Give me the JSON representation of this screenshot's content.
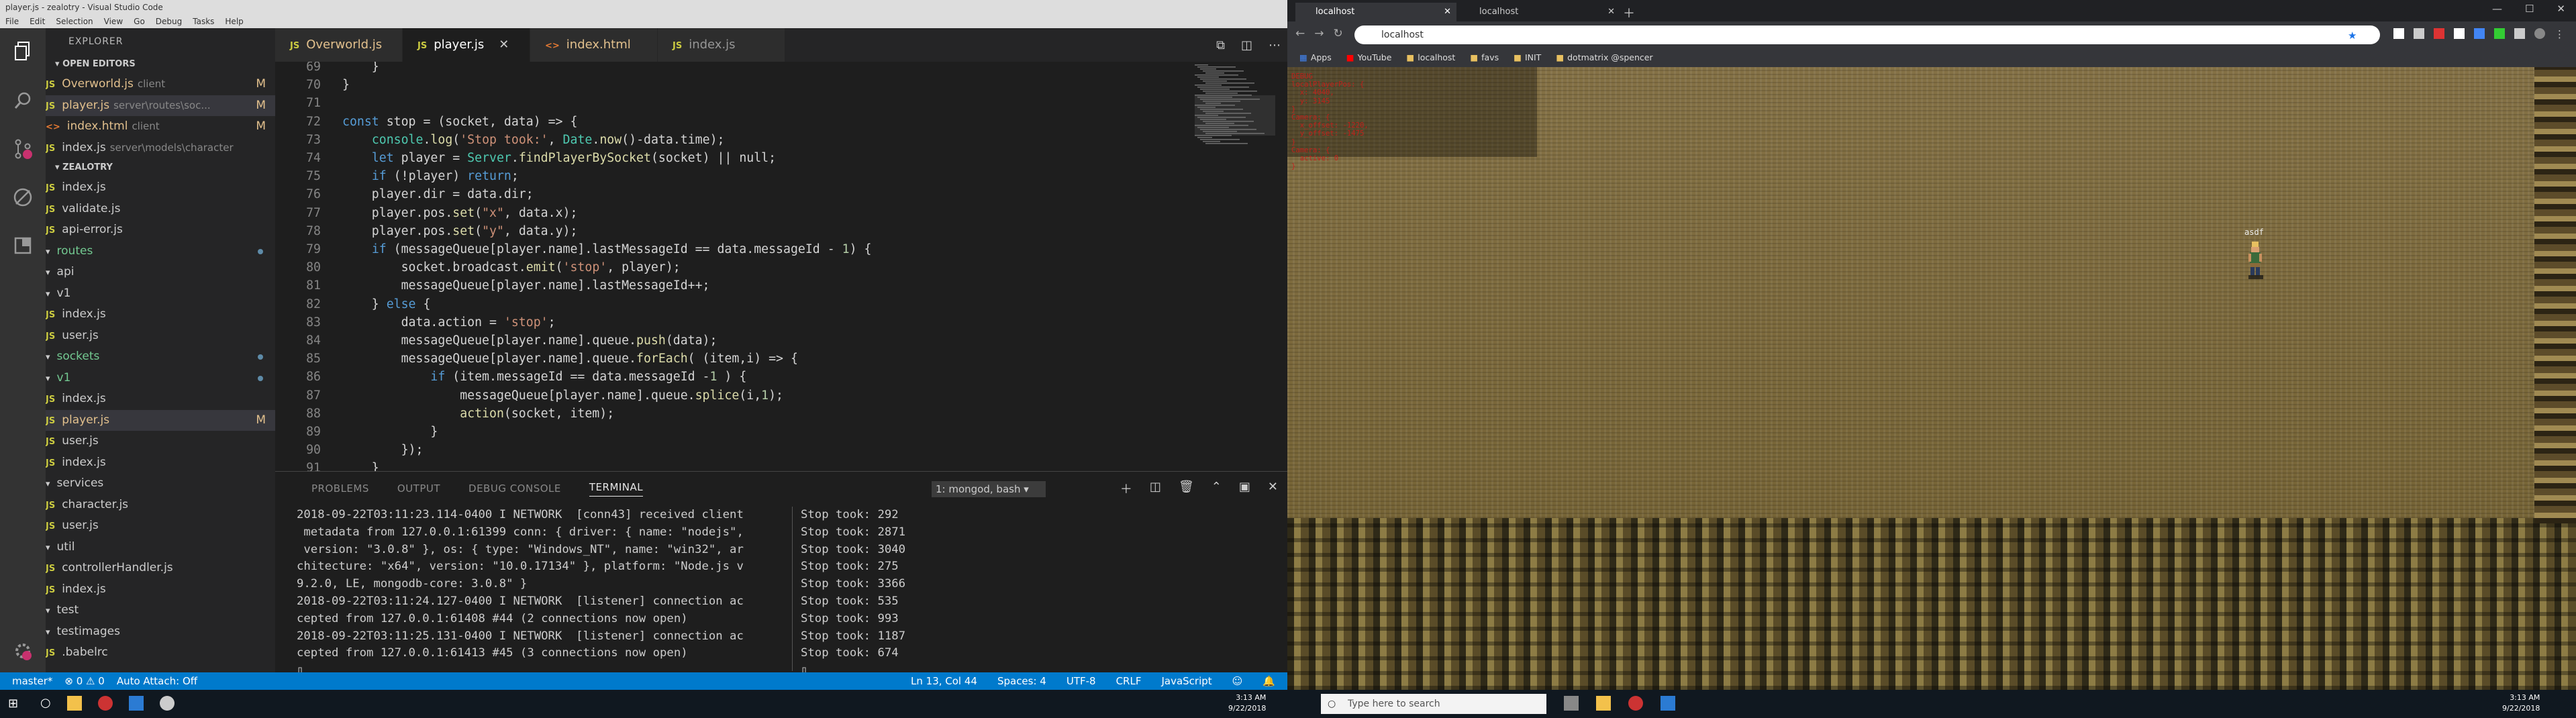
{
  "vs": {
    "title": "player.js - zealotry - Visual Studio Code",
    "menu": [
      "File",
      "Edit",
      "Selection",
      "View",
      "Go",
      "Debug",
      "Tasks",
      "Help"
    ],
    "explorer_title": "EXPLORER",
    "open_editors_label": "OPEN EDITORS",
    "open_editors": [
      {
        "name": "Overworld.js",
        "dir": "client",
        "badge": "M"
      },
      {
        "name": "player.js",
        "dir": "server\\routes\\soc...",
        "badge": "M"
      },
      {
        "name": "index.html",
        "dir": "client",
        "badge": "M"
      },
      {
        "name": "index.js",
        "dir": "server\\models\\character",
        "badge": ""
      }
    ],
    "project_label": "ZEALOTRY",
    "tree": [
      {
        "name": "index.js",
        "indent": 2,
        "kind": "js"
      },
      {
        "name": "validate.js",
        "indent": 2,
        "kind": "js"
      },
      {
        "name": "api-error.js",
        "indent": 1,
        "kind": "js"
      },
      {
        "name": "routes",
        "indent": 1,
        "kind": "folder",
        "dot": true
      },
      {
        "name": "api",
        "indent": 2,
        "kind": "folder"
      },
      {
        "name": "v1",
        "indent": 3,
        "kind": "folder"
      },
      {
        "name": "index.js",
        "indent": 4,
        "kind": "js"
      },
      {
        "name": "user.js",
        "indent": 4,
        "kind": "js"
      },
      {
        "name": "sockets",
        "indent": 2,
        "kind": "folder",
        "dot": true
      },
      {
        "name": "v1",
        "indent": 3,
        "kind": "folder",
        "dot": true
      },
      {
        "name": "index.js",
        "indent": 4,
        "kind": "js"
      },
      {
        "name": "player.js",
        "indent": 4,
        "kind": "js",
        "badge": "M",
        "selected": true
      },
      {
        "name": "user.js",
        "indent": 4,
        "kind": "js"
      },
      {
        "name": "index.js",
        "indent": 2,
        "kind": "js"
      },
      {
        "name": "services",
        "indent": 1,
        "kind": "folder"
      },
      {
        "name": "character.js",
        "indent": 2,
        "kind": "js"
      },
      {
        "name": "user.js",
        "indent": 2,
        "kind": "js"
      },
      {
        "name": "util",
        "indent": 1,
        "kind": "folder"
      },
      {
        "name": "controllerHandler.js",
        "indent": 2,
        "kind": "js"
      },
      {
        "name": "index.js",
        "indent": 1,
        "kind": "js"
      },
      {
        "name": "test",
        "indent": 0,
        "kind": "folder"
      },
      {
        "name": "testimages",
        "indent": 0,
        "kind": "folder"
      },
      {
        "name": ".babelrc",
        "indent": 0,
        "kind": "js"
      }
    ],
    "tabs": [
      {
        "label": "Overworld.js",
        "kind": "js"
      },
      {
        "label": "player.js",
        "kind": "js",
        "active": true
      },
      {
        "label": "index.html",
        "kind": "html"
      },
      {
        "label": "index.js",
        "kind": "js"
      }
    ],
    "code": [
      {
        "n": "69",
        "t": "    }"
      },
      {
        "n": "70",
        "t": "}"
      },
      {
        "n": "71",
        "t": ""
      },
      {
        "n": "72",
        "t": "const stop = (socket, data) => {"
      },
      {
        "n": "73",
        "t": "    console.log('Stop took:', Date.now()-data.time);"
      },
      {
        "n": "74",
        "t": "    let player = Server.findPlayerBySocket(socket) || null;"
      },
      {
        "n": "75",
        "t": "    if (!player) return;"
      },
      {
        "n": "76",
        "t": "    player.dir = data.dir;"
      },
      {
        "n": "77",
        "t": "    player.pos.set(\"x\", data.x);"
      },
      {
        "n": "78",
        "t": "    player.pos.set(\"y\", data.y);"
      },
      {
        "n": "79",
        "t": "    if (messageQueue[player.name].lastMessageId == data.messageId - 1) {"
      },
      {
        "n": "80",
        "t": "        socket.broadcast.emit('stop', player);"
      },
      {
        "n": "81",
        "t": "        messageQueue[player.name].lastMessageId++;"
      },
      {
        "n": "82",
        "t": "    } else {"
      },
      {
        "n": "83",
        "t": "        data.action = 'stop';"
      },
      {
        "n": "84",
        "t": "        messageQueue[player.name].queue.push(data);"
      },
      {
        "n": "85",
        "t": "        messageQueue[player.name].queue.forEach( (item,i) => {"
      },
      {
        "n": "86",
        "t": "            if (item.messageId == data.messageId -1 ) {"
      },
      {
        "n": "87",
        "t": "                messageQueue[player.name].queue.splice(i,1);"
      },
      {
        "n": "88",
        "t": "                action(socket, item);"
      },
      {
        "n": "89",
        "t": "            }"
      },
      {
        "n": "90",
        "t": "        });"
      },
      {
        "n": "91",
        "t": "    }"
      }
    ],
    "panel_tabs": [
      "PROBLEMS",
      "OUTPUT",
      "DEBUG CONSOLE",
      "TERMINAL"
    ],
    "terminal_select": "1: mongod, bash",
    "terminal_left": "2018-09-22T03:11:23.114-0400 I NETWORK  [conn43] received client\n metadata from 127.0.0.1:61399 conn: { driver: { name: \"nodejs\",\n version: \"3.0.8\" }, os: { type: \"Windows_NT\", name: \"win32\", ar\nchitecture: \"x64\", version: \"10.0.17134\" }, platform: \"Node.js v\n9.2.0, LE, mongodb-core: 3.0.8\" }\n2018-09-22T03:11:24.127-0400 I NETWORK  [listener] connection ac\ncepted from 127.0.0.1:61408 #44 (2 connections now open)\n2018-09-22T03:11:25.131-0400 I NETWORK  [listener] connection ac\ncepted from 127.0.0.1:61413 #45 (3 connections now open)\n▯",
    "terminal_right": "Stop took: 292\nStop took: 2871\nStop took: 3040\nStop took: 275\nStop took: 3366\nStop took: 535\nStop took: 993\nStop took: 1187\nStop took: 674\n▯",
    "status_left": [
      "master*",
      "⊗ 0  ⚠ 0",
      "Auto Attach: Off"
    ],
    "status_right": [
      "Ln 13, Col 44",
      "Spaces: 4",
      "UTF-8",
      "CRLF",
      "JavaScript"
    ]
  },
  "chrome": {
    "tabs": [
      "localhost",
      "localhost"
    ],
    "url": "localhost",
    "bookmarks": [
      "Apps",
      "YouTube",
      "localhost",
      "favs",
      "INIT",
      "dotmatrix @spencer"
    ]
  },
  "game": {
    "debug": "DEBUG\nlocalPlayerPos: {\n  x: 4040,\n  y: 3145\n}\nCamera: {\n  x_offset: -1220,\n  y_offset: -1475\n}\nCamera: {\n  active: 0\n}",
    "player_name": "asdf"
  },
  "taskbar": {
    "search_placeholder": "Type here to search",
    "time_left": "3:13 AM",
    "date_left": "9/22/2018",
    "time_right": "3:13 AM",
    "date_right": "9/22/2018"
  },
  "colors": {
    "accent": "#007acc",
    "debug_text": "#c0201a"
  }
}
